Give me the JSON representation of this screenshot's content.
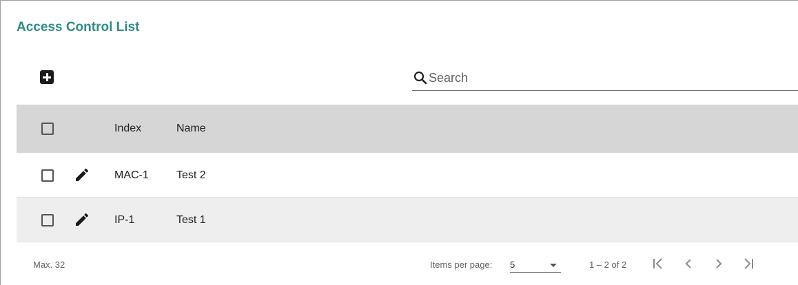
{
  "title": "Access Control List",
  "toolbar": {
    "add_icon": "add-box-icon",
    "search_icon": "search-icon",
    "search_placeholder": "Search",
    "search_value": ""
  },
  "table": {
    "columns": [
      "Index",
      "Name"
    ],
    "rows": [
      {
        "index": "MAC-1",
        "name": "Test 2",
        "edit_icon": "pencil-icon"
      },
      {
        "index": "IP-1",
        "name": "Test 1",
        "edit_icon": "pencil-icon"
      }
    ]
  },
  "footer": {
    "max": "Max. 32",
    "items_per_page_label": "Items per page:",
    "items_per_page_value": "5",
    "range": "1 – 2 of 2",
    "pager_icons": [
      "first-page-icon",
      "previous-page-icon",
      "next-page-icon",
      "last-page-icon"
    ]
  },
  "colors": {
    "title": "#2d8c87",
    "header_bg": "#d6d6d6",
    "alt_row_bg": "#eeeeee"
  }
}
